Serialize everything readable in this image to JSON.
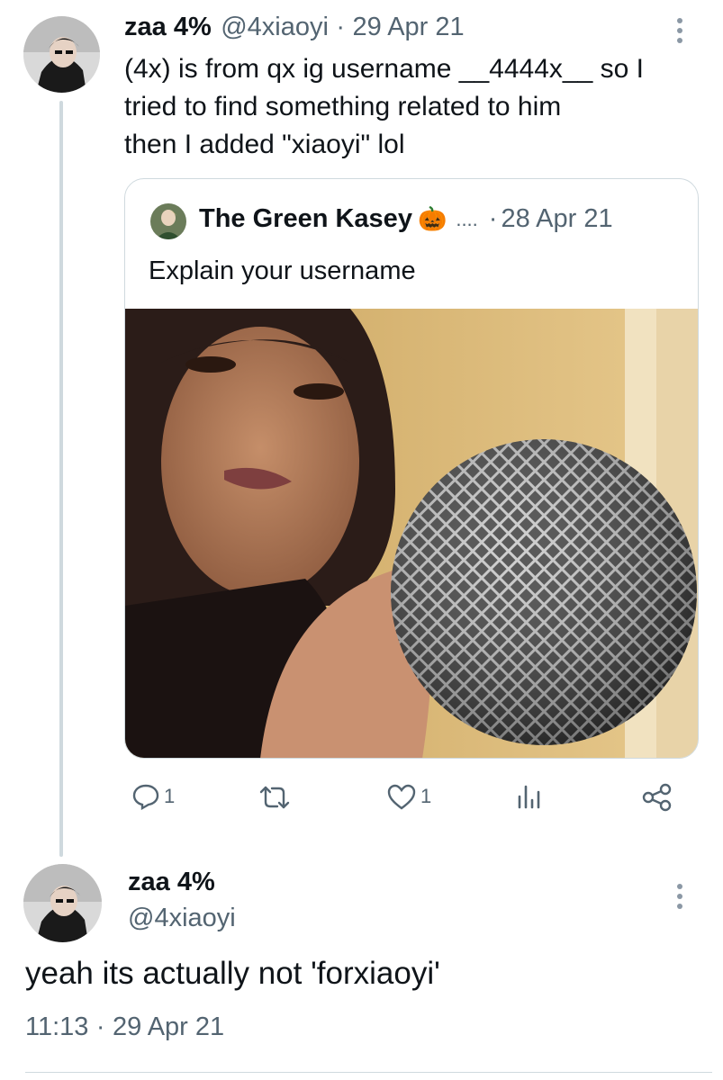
{
  "tweet1": {
    "display_name": "zaa 4%",
    "handle": "@4xiaoyi",
    "separator": "·",
    "date": "29 Apr 21",
    "lines": [
      "(4x) is from qx ig username __4444x__ so I",
      "tried to find something related to him",
      "then I added \"xiaoyi\" lol"
    ]
  },
  "quote": {
    "display_name": "The Green Kasey",
    "emoji": "🎃",
    "ellipsis": "....",
    "separator": "·",
    "date": "28 Apr 21",
    "text": "Explain your username"
  },
  "actions": {
    "reply_count": "1",
    "retweet_count": "",
    "like_count": "1"
  },
  "tweet2": {
    "display_name": "zaa 4%",
    "handle": "@4xiaoyi",
    "text": "yeah its actually not 'forxiaoyi'",
    "time": "11:13",
    "separator": "·",
    "date": "29 Apr 21"
  },
  "colors": {
    "text": "#0f1419",
    "secondary": "#536471",
    "border": "#cfd9de"
  }
}
